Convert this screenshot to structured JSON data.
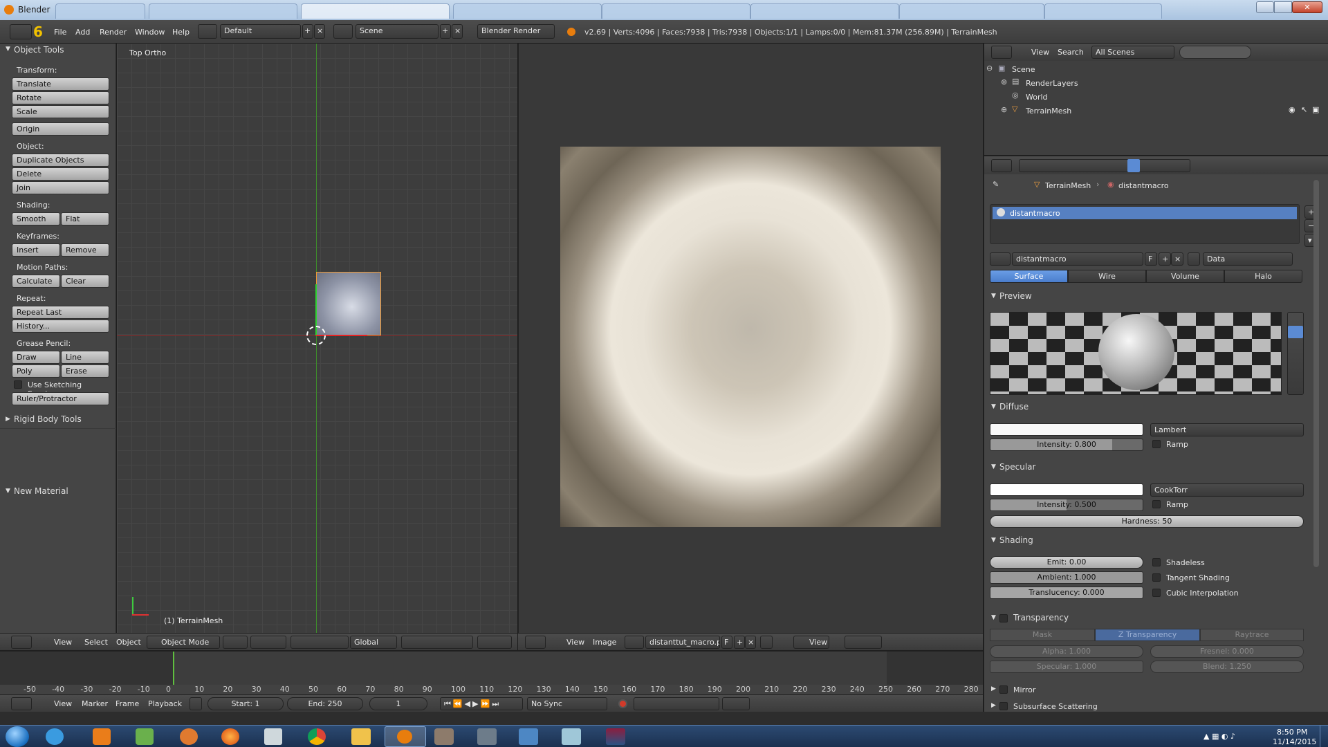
{
  "window": {
    "title": "Blender"
  },
  "menu": {
    "file": "File",
    "add": "Add",
    "render": "Render",
    "window": "Window",
    "help": "Help",
    "layout": "Default",
    "scene": "Scene",
    "engine": "Blender Render",
    "stats": "v2.69 | Verts:4096 | Faces:7938 | Tris:7938 | Objects:1/1 | Lamps:0/0 | Mem:81.37M (256.89M) | TerrainMesh"
  },
  "tools": {
    "header": "Object Tools",
    "transform": "Transform:",
    "translate": "Translate",
    "rotate": "Rotate",
    "scale": "Scale",
    "origin": "Origin",
    "object": "Object:",
    "duplicate": "Duplicate Objects",
    "delete": "Delete",
    "join": "Join",
    "shading": "Shading:",
    "smooth": "Smooth",
    "flat": "Flat",
    "keyframes": "Keyframes:",
    "insert": "Insert",
    "remove": "Remove",
    "motion": "Motion Paths:",
    "calculate": "Calculate",
    "clear": "Clear",
    "repeat": "Repeat:",
    "repeat_last": "Repeat Last",
    "history": "History...",
    "grease": "Grease Pencil:",
    "draw": "Draw",
    "line": "Line",
    "poly": "Poly",
    "erase": "Erase",
    "sketching": "Use Sketching Sessions",
    "ruler": "Ruler/Protractor",
    "rigid": "Rigid Body Tools",
    "new_material": "New Material"
  },
  "viewport": {
    "label": "Top Ortho",
    "object_label": "(1) TerrainMesh",
    "header": {
      "view": "View",
      "select": "Select",
      "object": "Object",
      "mode": "Object Mode",
      "orientation": "Global"
    }
  },
  "image_editor": {
    "header": {
      "view": "View",
      "image": "Image",
      "image_name": "distanttut_macro.png",
      "f": "F",
      "view2": "View"
    }
  },
  "timeline": {
    "ticks": [
      "-50",
      "-40",
      "-30",
      "-20",
      "-10",
      "0",
      "10",
      "20",
      "30",
      "40",
      "50",
      "60",
      "70",
      "80",
      "90",
      "100",
      "110",
      "120",
      "130",
      "140",
      "150",
      "160",
      "170",
      "180",
      "190",
      "200",
      "210",
      "220",
      "230",
      "240",
      "250",
      "260",
      "270",
      "280"
    ],
    "view": "View",
    "marker": "Marker",
    "frame": "Frame",
    "playback": "Playback",
    "start": "Start: 1",
    "end": "End: 250",
    "current": "1",
    "sync": "No Sync"
  },
  "outliner": {
    "view": "View",
    "search": "Search",
    "scenes": "All Scenes",
    "items": [
      "Scene",
      "RenderLayers",
      "World",
      "TerrainMesh"
    ]
  },
  "properties": {
    "breadcrumb_mesh": "TerrainMesh",
    "breadcrumb_mat": "distantmacro",
    "slot": "distantmacro",
    "mat_name": "distantmacro",
    "f": "F",
    "data": "Data",
    "tabs": [
      "Surface",
      "Wire",
      "Volume",
      "Halo"
    ],
    "preview": "Preview",
    "diffuse": "Diffuse",
    "diffuse_shader": "Lambert",
    "diffuse_intensity": "Intensity: 0.800",
    "ramp": "Ramp",
    "specular": "Specular",
    "spec_shader": "CookTorr",
    "spec_intensity": "Intensity: 0.500",
    "hardness": "Hardness: 50",
    "shading": "Shading",
    "emit": "Emit: 0.00",
    "ambient": "Ambient: 1.000",
    "translucency": "Translucency: 0.000",
    "shadeless": "Shadeless",
    "tangent": "Tangent Shading",
    "cubic": "Cubic Interpolation",
    "transparency": "Transparency",
    "mask": "Mask",
    "ztrans": "Z Transparency",
    "raytrace": "Raytrace",
    "alpha": "Alpha: 1.000",
    "fresnel": "Fresnel: 0.000",
    "specular_t": "Specular: 1.000",
    "blend": "Blend: 1.250",
    "mirror": "Mirror",
    "sss": "Subsurface Scattering"
  },
  "taskbar": {
    "time": "8:50 PM",
    "date": "11/14/2015"
  }
}
